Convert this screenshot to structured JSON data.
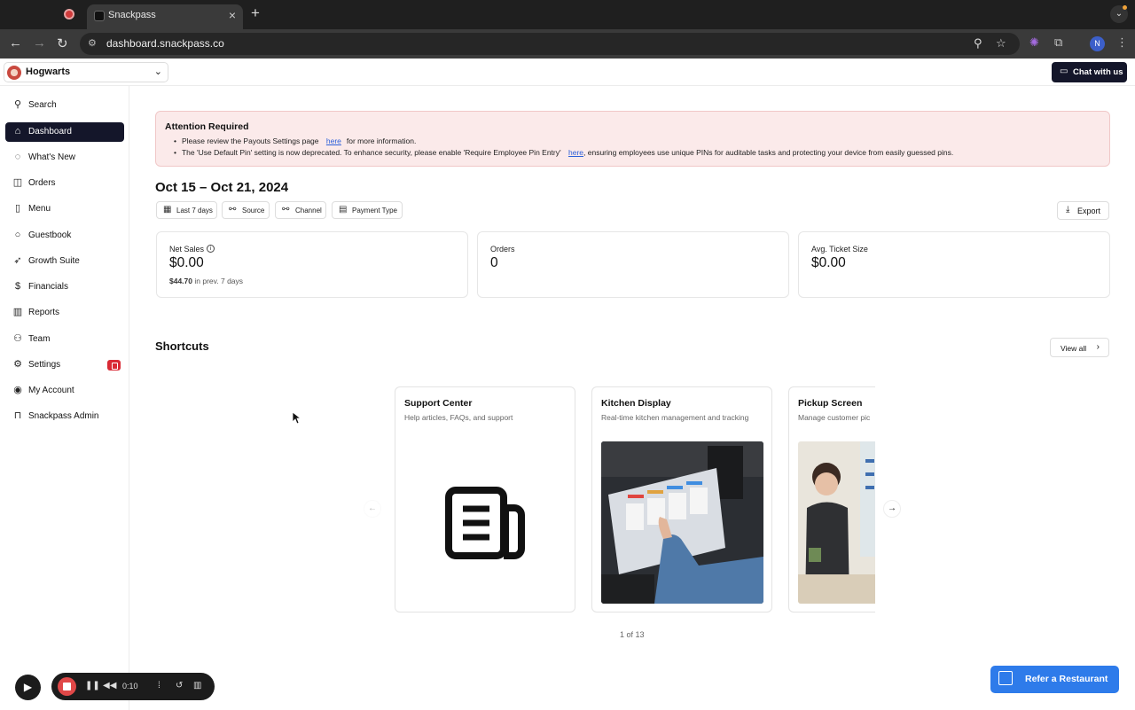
{
  "browser": {
    "tab_title": "Snackpass",
    "url": "dashboard.snackpass.co",
    "profile_initial": "N"
  },
  "header": {
    "store_name": "Hogwarts",
    "chat_label": "Chat with us"
  },
  "sidebar": {
    "items": [
      {
        "label": "Search",
        "icon": "search-icon"
      },
      {
        "label": "Dashboard",
        "icon": "home-icon",
        "active": true
      },
      {
        "label": "What's New",
        "icon": "bell-icon"
      },
      {
        "label": "Orders",
        "icon": "bag-icon"
      },
      {
        "label": "Menu",
        "icon": "book-icon"
      },
      {
        "label": "Guestbook",
        "icon": "chat-bubble-icon"
      },
      {
        "label": "Growth Suite",
        "icon": "rocket-icon"
      },
      {
        "label": "Financials",
        "icon": "dollar-icon"
      },
      {
        "label": "Reports",
        "icon": "bar-chart-icon"
      },
      {
        "label": "Team",
        "icon": "people-icon"
      },
      {
        "label": "Settings",
        "icon": "gear-icon",
        "badge": true
      },
      {
        "label": "My Account",
        "icon": "user-circle-icon"
      },
      {
        "label": "Snackpass Admin",
        "icon": "lock-icon"
      }
    ]
  },
  "alert": {
    "title": "Attention Required",
    "line1_pre": "Please review the Payouts Settings page",
    "line1_link": "here",
    "line1_post": "for more information.",
    "line2_pre": "The 'Use Default Pin' setting is now deprecated. To enhance security, please enable 'Require Employee Pin Entry'",
    "line2_link": "here",
    "line2_post": ", ensuring employees use unique PINs for auditable tasks and protecting your device from easily guessed pins."
  },
  "date_range": "Oct 15 – Oct 21, 2024",
  "filters": [
    "Last 7 days",
    "Source",
    "Channel",
    "Payment Type"
  ],
  "export_label": "Export",
  "stats": {
    "net_sales": {
      "label": "Net Sales",
      "value": "$0.00",
      "prev_value": "$44.70",
      "prev_suffix": "in prev. 7 days"
    },
    "orders": {
      "label": "Orders",
      "value": "0"
    },
    "avg_ticket": {
      "label": "Avg. Ticket Size",
      "value": "$0.00"
    }
  },
  "shortcuts": {
    "title": "Shortcuts",
    "view_all": "View all",
    "cards": [
      {
        "title": "Support Center",
        "desc": "Help articles, FAQs, and support"
      },
      {
        "title": "Kitchen Display",
        "desc": "Real-time kitchen management and tracking"
      },
      {
        "title": "Pickup Screen",
        "desc": "Manage customer pic"
      }
    ],
    "pager": "1 of 13"
  },
  "refer_label": "Refer a Restaurant",
  "recorder": {
    "time": "0:10"
  }
}
